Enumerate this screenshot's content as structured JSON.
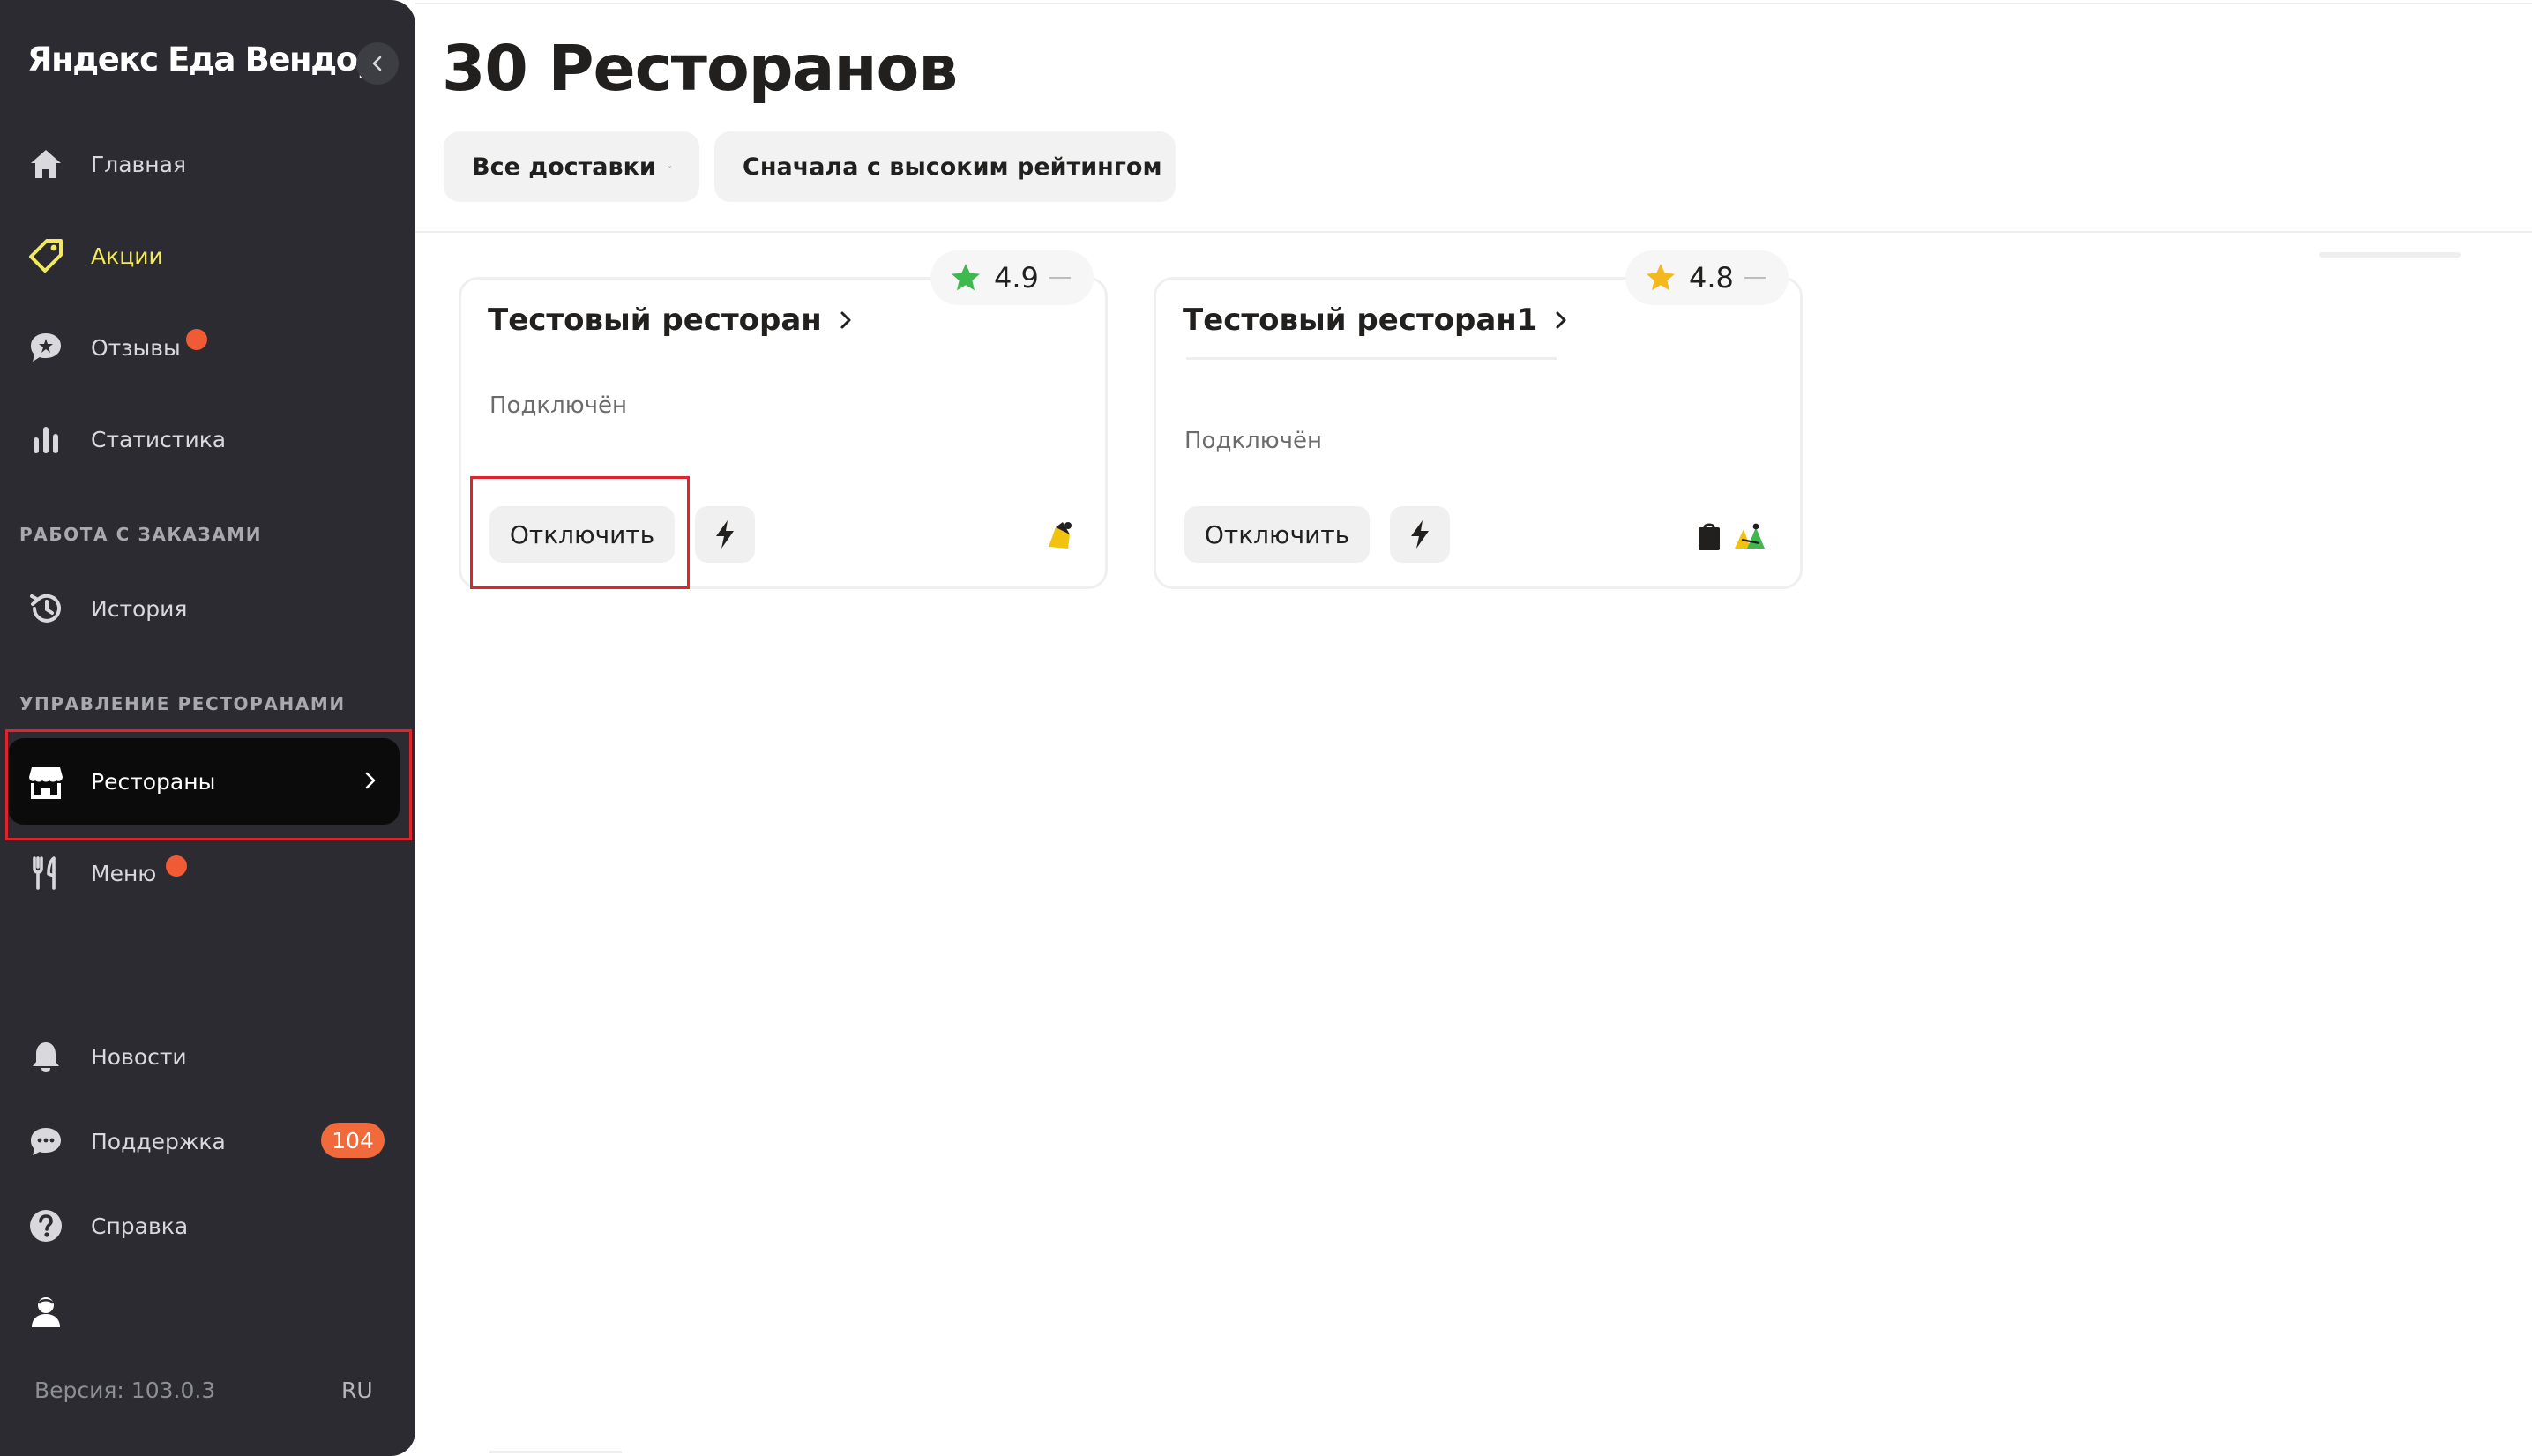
{
  "app": {
    "logo": "Яндекс Еда Вендор"
  },
  "sidebar": {
    "items": {
      "home": "Главная",
      "promo": "Акции",
      "reviews": "Отзывы",
      "stats": "Статистика",
      "history": "История",
      "restaurants": "Рестораны",
      "menu": "Меню",
      "news": "Новости",
      "support": "Поддержка",
      "help": "Справка"
    },
    "sections": {
      "orders": "РАБОТА С ЗАКАЗАМИ",
      "management": "УПРАВЛЕНИЕ РЕСТОРАНАМИ"
    },
    "support_count": "104",
    "version": "Версия: 103.0.3",
    "lang": "RU"
  },
  "main": {
    "title": "30 Ресторанов",
    "filters": {
      "delivery": "Все доставки",
      "sort": "Сначала с высоким рейтингом"
    },
    "cards": [
      {
        "name": "Тестовый ресторан",
        "status": "Подключён",
        "rating": "4.9",
        "button": "Отключить"
      },
      {
        "name": "Тестовый ресторан1",
        "status": "Подключён",
        "rating": "4.8",
        "button": "Отключить"
      }
    ]
  },
  "colors": {
    "sidebar_bg": "#2b2b31",
    "promo_accent": "#f2e95e",
    "badge": "#f05a34",
    "highlight": "#e0242d",
    "rating_green": "#3fb94e",
    "rating_yellow": "#f2b81d"
  }
}
